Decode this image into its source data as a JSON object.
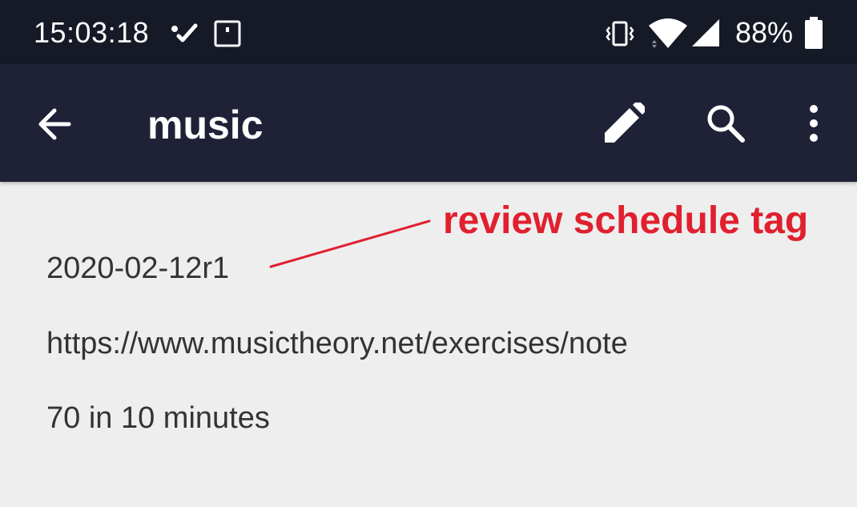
{
  "status_bar": {
    "time": "15:03:18",
    "battery": "88%",
    "icons": [
      "check-notification-icon",
      "screenshot-notification-icon",
      "vibrate-icon",
      "wifi-icon",
      "cell-signal-icon",
      "battery-icon"
    ]
  },
  "app_bar": {
    "title": "music",
    "icons": [
      "back-arrow-icon",
      "edit-pencil-icon",
      "search-icon",
      "more-vert-icon"
    ]
  },
  "note": {
    "lines": [
      "2020-02-12r1",
      "https://www.musictheory.net/exercises/note",
      "70 in 10 minutes"
    ]
  },
  "annotation": {
    "label": "review schedule tag",
    "color": "#e0202f"
  },
  "colors": {
    "status_bar_bg": "#161a27",
    "app_bar_bg": "#1f2137",
    "content_bg": "#eeeeee",
    "text": "#333333"
  }
}
